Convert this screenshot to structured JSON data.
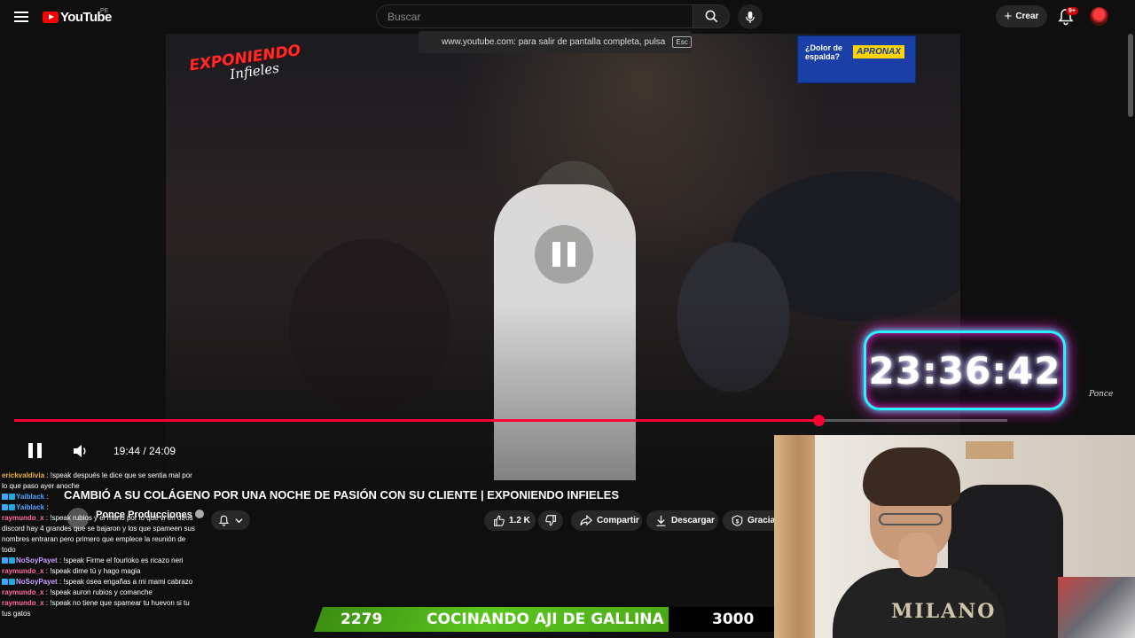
{
  "header": {
    "logo_text": "YouTube",
    "country_code": "PE",
    "search_placeholder": "Buscar",
    "create_label": "Crear",
    "notifications_badge": "9+"
  },
  "video": {
    "fullscreen_hint": "www.youtube.com: para salir de pantalla completa, pulsa",
    "esc_key": "Esc",
    "brand_logo": "EXPONIENDO INFIELES",
    "billboard_text": "¿Dolor de espalda?",
    "billboard_brand": "APRONAX",
    "timer": "23:36:42",
    "watermark": "Ponce",
    "progress_fraction": 0.81,
    "current_time": "19:44",
    "duration": "24:09",
    "time_display": "19:44 / 24:09"
  },
  "details": {
    "title": "CAMBIÓ A SU COLÁGENO POR UNA NOCHE DE PASIÓN CON SU CLIENTE | EXPONIENDO INFIELES",
    "channel": "Ponce Producciones",
    "likes": "1.2 K",
    "share_label": "Compartir",
    "download_label": "Descargar",
    "thanks_label": "Gracias"
  },
  "chat": [
    {
      "user": "erickvaldivia",
      "color": "#e8b23a",
      "text": " : !speak después le dice que se sentia mal por lo que paso ayer anoche"
    },
    {
      "user": "Yaiblack",
      "color": "#4aa3ff",
      "text": " :",
      "badges": true
    },
    {
      "user": "Yaiblack",
      "color": "#4aa3ff",
      "text": " :",
      "badges": true
    },
    {
      "user": "raymundo_x",
      "color": "#ff6b9a",
      "text": " : !speak rubios y el mano por lo que vi en otros discord hay 4 grandes que se bajaron y los que spameen sus nombres entraran pero primero que emplece la reunión de todo"
    },
    {
      "user": "NoSoyPayet",
      "color": "#c8a0ff",
      "text": " : !speak Firme el fourloko es ricazo neri",
      "badges": true
    },
    {
      "user": "raymundo_x",
      "color": "#ff6b9a",
      "text": " : !speak dime tú y hago magia"
    },
    {
      "user": "NoSoyPayet",
      "color": "#c8a0ff",
      "text": " : !speak osea engañas a mi mami cabrazo",
      "badges": true
    },
    {
      "user": "raymundo_x",
      "color": "#ff6b9a",
      "text": " : !speak auron rubios y comanche"
    },
    {
      "user": "raymundo_x",
      "color": "#ff6b9a",
      "text": " : !speak no tiene que spamear tu huevon si tu tus gatos"
    }
  ],
  "banner": {
    "left_value": "2279",
    "center_text": "COCINANDO AJI DE GALLINA",
    "right_value": "3000"
  },
  "webcam": {
    "shirt_text": "MILANO"
  },
  "colors": {
    "progress": "#ff0033",
    "youtube_red": "#ff0000",
    "banner_green": "#59c51e"
  }
}
